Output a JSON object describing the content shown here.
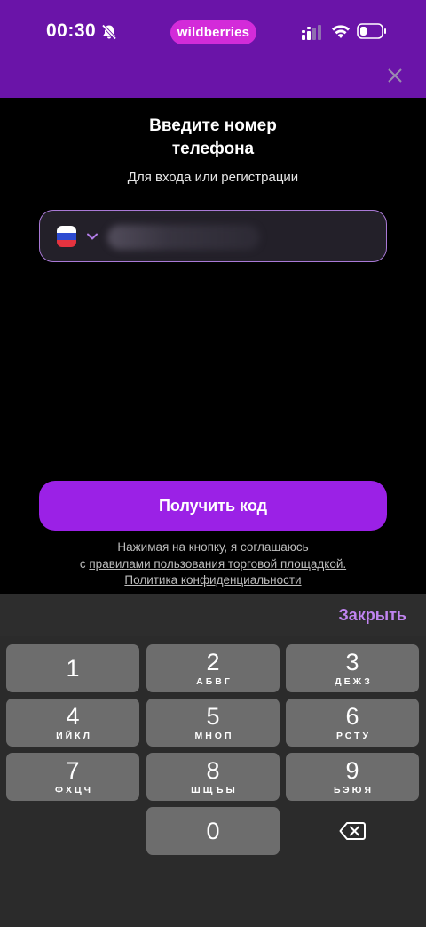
{
  "status": {
    "time": "00:30",
    "brand": "wildberries"
  },
  "header": {
    "close_label": "close"
  },
  "form": {
    "title": "Введите номер\nтелефона",
    "subtitle": "Для входа или регистрации",
    "country": "RU",
    "submit_label": "Получить код"
  },
  "terms": {
    "line1": "Нажимая на кнопку, я соглашаюсь",
    "prefix": "с",
    "rules_link": "правилами пользования торговой площадкой.",
    "privacy_link": "Политика конфиденциальности"
  },
  "keyboard": {
    "close_label": "Закрыть",
    "keys": [
      {
        "digit": "1",
        "letters": ""
      },
      {
        "digit": "2",
        "letters": "АБВГ"
      },
      {
        "digit": "3",
        "letters": "ДЕЖЗ"
      },
      {
        "digit": "4",
        "letters": "ИЙКЛ"
      },
      {
        "digit": "5",
        "letters": "МНОП"
      },
      {
        "digit": "6",
        "letters": "РСТУ"
      },
      {
        "digit": "7",
        "letters": "ФХЦЧ"
      },
      {
        "digit": "8",
        "letters": "ШЩЪЫ"
      },
      {
        "digit": "9",
        "letters": "ЬЭЮЯ"
      },
      {
        "digit": "0",
        "letters": ""
      }
    ]
  },
  "colors": {
    "header": "#6a14a8",
    "accent": "#9b21e6",
    "brand_pill": "#d32bd9",
    "link_accent": "#c084f0"
  }
}
